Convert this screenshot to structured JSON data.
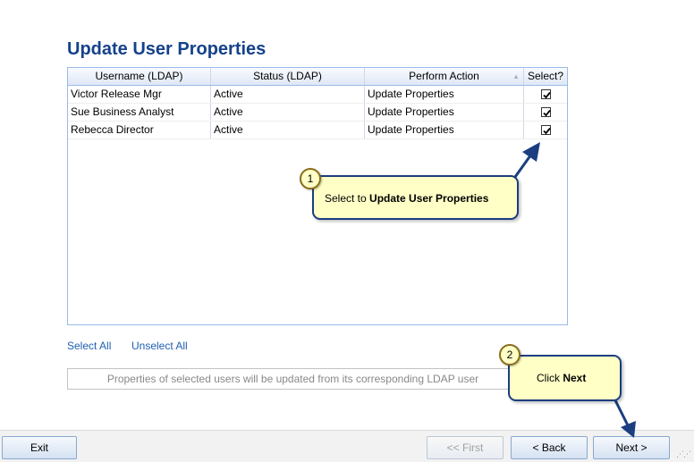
{
  "page": {
    "title": "Update User Properties"
  },
  "grid": {
    "columns": [
      "Username (LDAP)",
      "Status (LDAP)",
      "Perform Action",
      "Select?"
    ],
    "sort_icon": "sort-arrow-icon",
    "rows": [
      {
        "username": "Victor Release Mgr",
        "status": "Active",
        "action": "Update Properties",
        "selected": true
      },
      {
        "username": "Sue Business Analyst",
        "status": "Active",
        "action": "Update Properties",
        "selected": true
      },
      {
        "username": "Rebecca Director",
        "status": "Active",
        "action": "Update Properties",
        "selected": true
      }
    ]
  },
  "links": {
    "select_all": "Select All",
    "unselect_all": "Unselect All"
  },
  "info": {
    "text": "Properties of selected users will be updated from its corresponding LDAP user"
  },
  "footer": {
    "exit": "Exit",
    "first": "<< First",
    "back": "< Back",
    "next": "Next >"
  },
  "callouts": {
    "one": {
      "number": "1",
      "text_prefix": "Select to ",
      "text_bold": "Update User Properties"
    },
    "two": {
      "number": "2",
      "text_prefix": "Click ",
      "text_bold": "Next"
    }
  },
  "colors": {
    "title": "#15428b",
    "grid_border": "#99bbe8",
    "link": "#1e5fb3",
    "callout_bg": "#ffffc6",
    "callout_border": "#1a3e80"
  }
}
